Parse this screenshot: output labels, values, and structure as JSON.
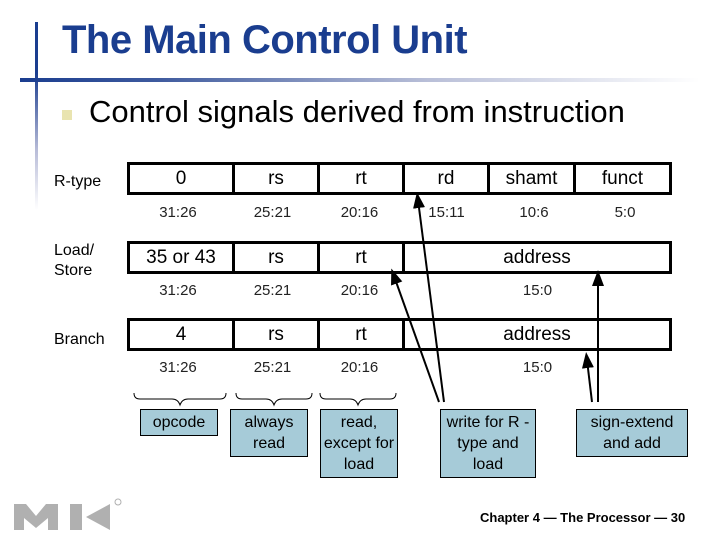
{
  "slide": {
    "title": "The Main Control Unit",
    "bullet": "Control signals derived from instruction",
    "footer": "Chapter 4 — The Processor — 30",
    "logo": "MK",
    "colors": {
      "title": "#1a3d8f",
      "note_fill": "#a6cbd8",
      "bullet": "#e9e4b0"
    }
  },
  "formats": [
    {
      "label": "R-type",
      "fields": [
        "0",
        "rs",
        "rt",
        "rd",
        "shamt",
        "funct"
      ],
      "bits": [
        "31:26",
        "25:21",
        "20:16",
        "15:11",
        "10:6",
        "5:0"
      ]
    },
    {
      "label": "Load/ Store",
      "fields": [
        "35 or 43",
        "rs",
        "rt",
        "address"
      ],
      "bits": [
        "31:26",
        "25:21",
        "20:16",
        "15:0"
      ]
    },
    {
      "label": "Branch",
      "fields": [
        "4",
        "rs",
        "rt",
        "address"
      ],
      "bits": [
        "31:26",
        "25:21",
        "20:16",
        "15:0"
      ]
    }
  ],
  "notes": [
    {
      "text": "opcode"
    },
    {
      "text": "always read"
    },
    {
      "text": "read, except for load"
    },
    {
      "text": "write for R -type and load"
    },
    {
      "text": "sign-extend and add"
    }
  ]
}
